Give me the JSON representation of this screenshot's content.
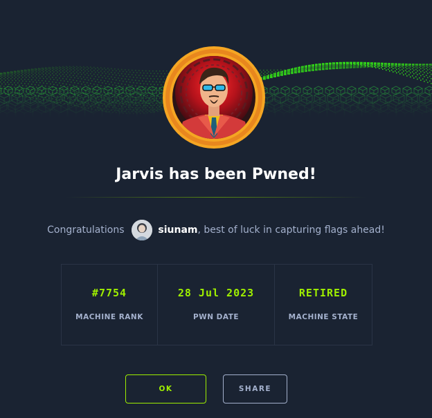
{
  "header": {
    "title": "Jarvis has been Pwned!"
  },
  "congrats": {
    "prefix": "Congratulations",
    "username": "siunam",
    "suffix": ", best of luck in capturing flags ahead!"
  },
  "stats": [
    {
      "value": "#7754",
      "label": "MACHINE RANK"
    },
    {
      "value": "28 Jul 2023",
      "label": "PWN DATE"
    },
    {
      "value": "RETIRED",
      "label": "MACHINE STATE"
    }
  ],
  "actions": {
    "ok_label": "OK",
    "share_label": "SHARE"
  },
  "colors": {
    "background": "#1a2332",
    "accent": "#9fef00",
    "muted_text": "#a4b1cd",
    "avatar_ring": "#f5a623"
  },
  "icons": {
    "banner": "green-cube-wave-banner",
    "machine_avatar": "jarvis-machine-avatar",
    "user_avatar": "user-avatar"
  }
}
